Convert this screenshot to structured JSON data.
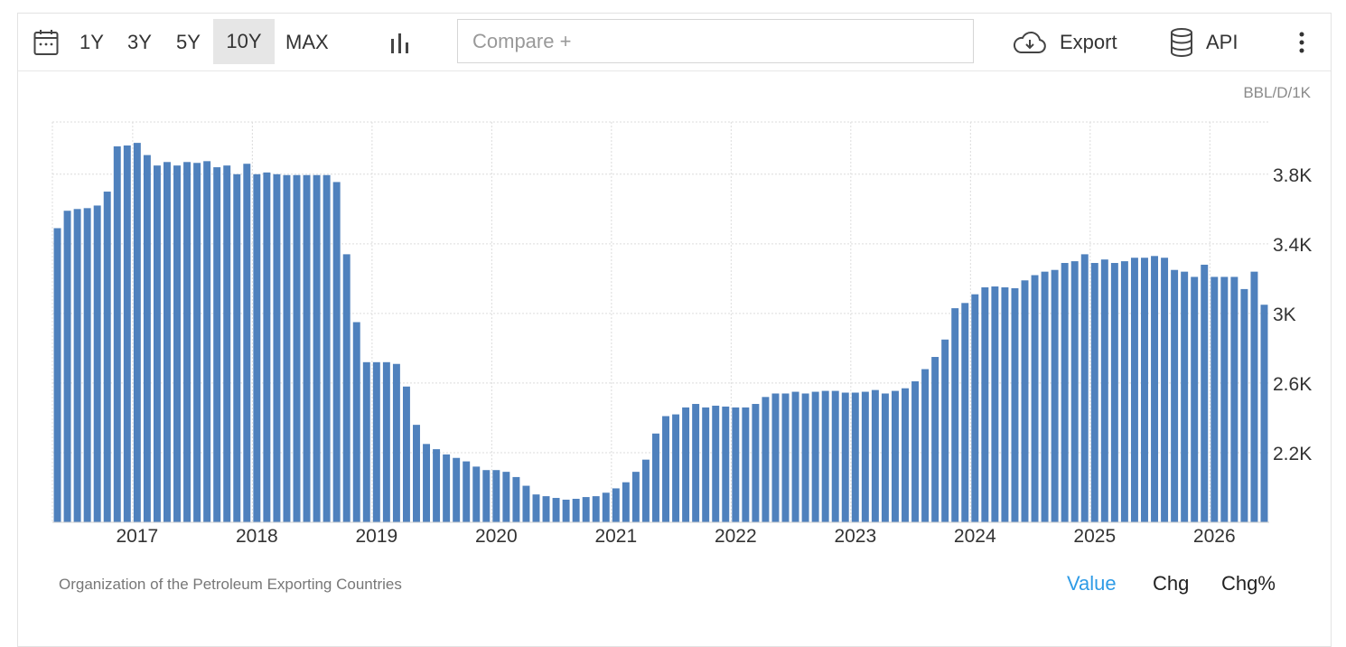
{
  "toolbar": {
    "ranges": [
      "1Y",
      "3Y",
      "5Y",
      "10Y",
      "MAX"
    ],
    "active_range": "10Y",
    "compare_placeholder": "Compare +",
    "export_label": "Export",
    "api_label": "API",
    "icons": [
      "calendar-icon",
      "bar-chart-icon",
      "cloud-download-icon",
      "database-icon",
      "more-vertical-icon"
    ]
  },
  "unit_label": "BBL/D/1K",
  "source": "Organization of the Petroleum Exporting Countries",
  "tabs": {
    "value": "Value",
    "chg": "Chg",
    "chg_pct": "Chg%",
    "active": "Value"
  },
  "colors": {
    "bar": "#4f81bd",
    "active_tab": "#2e9be6",
    "grid": "#dcdcdc"
  },
  "chart_data": {
    "type": "bar",
    "y_ticks": [
      "2.2K",
      "2.6K",
      "3K",
      "3.4K",
      "3.8K"
    ],
    "y_tick_values": [
      2200,
      2600,
      3000,
      3400,
      3800
    ],
    "ylim": [
      1800,
      4100
    ],
    "x_tick_labels": [
      "2017",
      "2018",
      "2019",
      "2020",
      "2021",
      "2022",
      "2023",
      "2024",
      "2025",
      "2026"
    ],
    "x_tick_bar_index": [
      9,
      21,
      33,
      45,
      57,
      69,
      81,
      93,
      105,
      117
    ],
    "grid": true,
    "values": [
      3490,
      3590,
      3600,
      3605,
      3620,
      3700,
      3960,
      3965,
      3980,
      3910,
      3850,
      3870,
      3850,
      3870,
      3865,
      3875,
      3840,
      3850,
      3800,
      3860,
      3800,
      3810,
      3800,
      3795,
      3795,
      3795,
      3795,
      3795,
      3755,
      3340,
      2950,
      2720,
      2720,
      2720,
      2710,
      2580,
      2360,
      2250,
      2220,
      2190,
      2170,
      2150,
      2120,
      2100,
      2100,
      2090,
      2060,
      2010,
      1960,
      1950,
      1940,
      1930,
      1935,
      1945,
      1950,
      1970,
      1995,
      2030,
      2090,
      2160,
      2310,
      2410,
      2420,
      2460,
      2480,
      2460,
      2470,
      2465,
      2460,
      2460,
      2480,
      2520,
      2540,
      2540,
      2550,
      2540,
      2550,
      2555,
      2555,
      2545,
      2545,
      2550,
      2560,
      2540,
      2555,
      2570,
      2610,
      2680,
      2750,
      2850,
      3030,
      3060,
      3110,
      3150,
      3155,
      3150,
      3145,
      3190,
      3220,
      3240,
      3250,
      3290,
      3300,
      3340,
      3290,
      3310,
      3290,
      3300,
      3320,
      3320,
      3330,
      3320,
      3250,
      3240,
      3210,
      3280,
      3210,
      3210,
      3210,
      3140,
      3240,
      3050
    ]
  }
}
